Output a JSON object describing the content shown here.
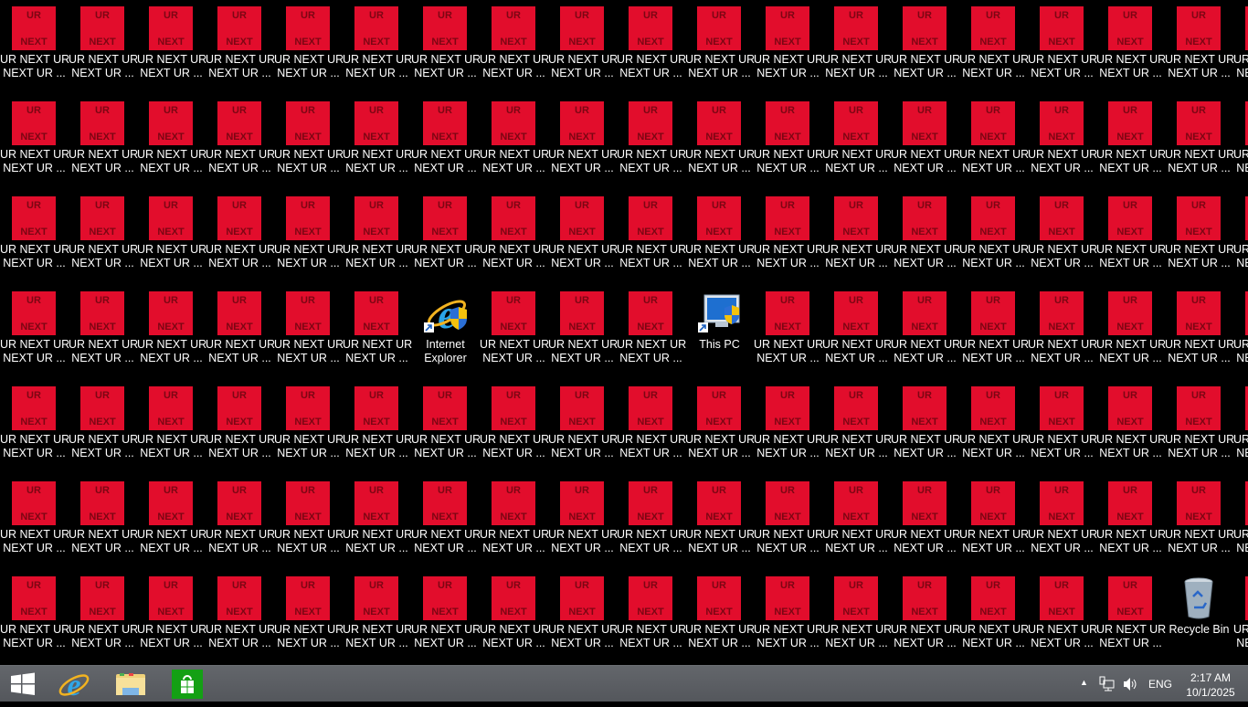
{
  "desktop": {
    "columns": 19,
    "rows": 7,
    "default_icon": {
      "glyph_top": "UR",
      "glyph_bottom": "NEXT",
      "label_line1": "UR NEXT UR",
      "label_line2": "NEXT UR ...",
      "color": "#e20d2c"
    },
    "special_icons": [
      {
        "slot": 63,
        "name": "internet-explorer",
        "label_line1": "Internet",
        "label_line2": "Explorer"
      },
      {
        "slot": 67,
        "name": "this-pc",
        "label_line1": "This PC",
        "label_line2": ""
      },
      {
        "slot": 131,
        "name": "recycle-bin",
        "label_line1": "Recycle Bin",
        "label_line2": ""
      }
    ]
  },
  "taskbar": {
    "pinned": [
      "Start",
      "Internet Explorer",
      "File Explorer",
      "Store"
    ],
    "language": "ENG",
    "time": "2:17 AM",
    "date": "10/1/2025"
  }
}
